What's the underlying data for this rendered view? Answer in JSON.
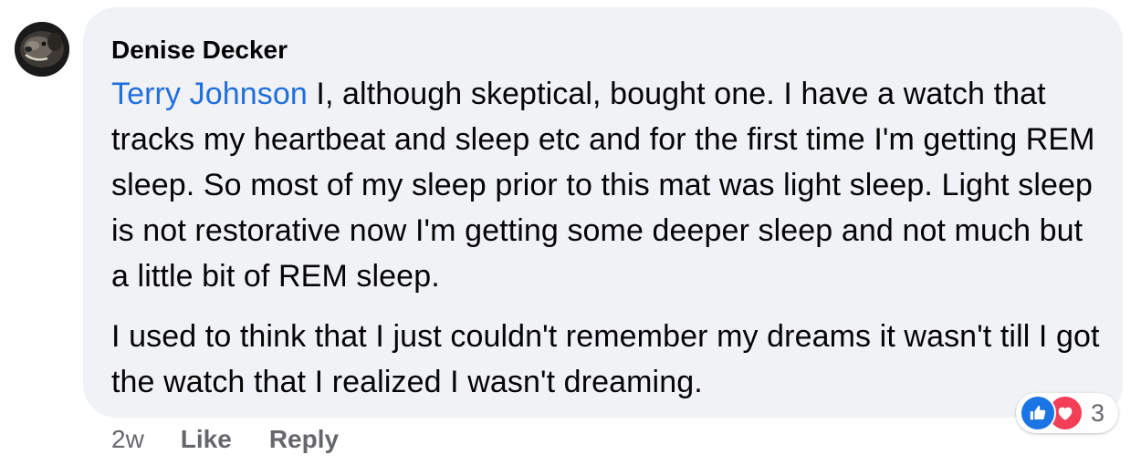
{
  "comment": {
    "author": "Denise Decker",
    "mention": "Terry Johnson",
    "paragraph_1_text": " I, although skeptical, bought one. I have a watch that tracks my heartbeat and sleep etc and for the first time I'm getting REM sleep. So most of my sleep prior to this mat was light sleep. Light sleep is not restorative now I'm getting some deeper sleep and not much but a little bit of REM sleep.",
    "paragraph_2_text": "I used to think that I just couldn't remember my dreams it wasn't till I got the watch that I realized I wasn't dreaming.",
    "reactions": {
      "icons": [
        "thumbs-up-icon",
        "heart-icon"
      ],
      "count": "3"
    },
    "actions": {
      "timestamp": "2w",
      "like_label": "Like",
      "reply_label": "Reply"
    }
  },
  "colors": {
    "bubble": "#f0f2f5",
    "mention": "#216fdb",
    "like": "#1b74e4",
    "love": "#f33e58",
    "muted": "#65676b"
  }
}
